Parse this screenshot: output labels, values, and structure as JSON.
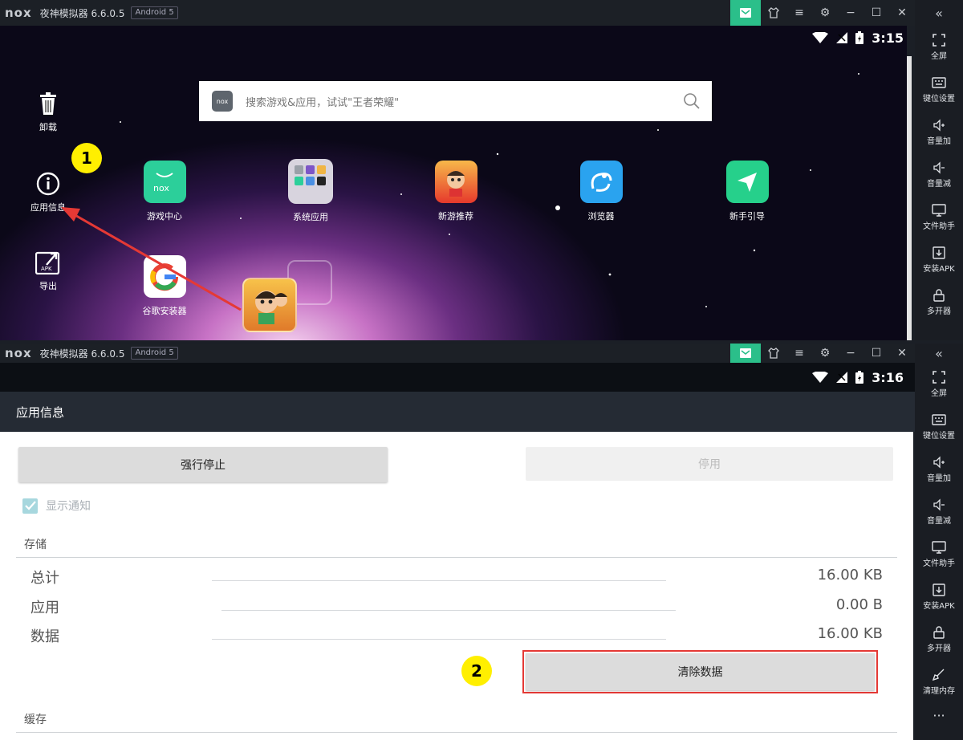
{
  "window1": {
    "logo": "nox",
    "title": "夜神模拟器 6.6.0.5",
    "os_badge": "Android 5",
    "status_time": "3:15",
    "search_placeholder": "搜索游戏&应用，试试\"王者荣耀\"",
    "drop_targets": [
      {
        "label": "卸载",
        "icon": "trash-icon"
      },
      {
        "label": "应用信息",
        "icon": "info-icon"
      },
      {
        "label": "导出",
        "icon": "export-apk-icon"
      }
    ],
    "apps": [
      {
        "label": "游戏中心",
        "icon": "nox-game-center-icon",
        "color": "#2ccf9a"
      },
      {
        "label": "系统应用",
        "icon": "folder-icon",
        "color": "#d8d4de"
      },
      {
        "label": "新游推荐",
        "icon": "new-games-icon",
        "color": "#e6392c"
      },
      {
        "label": "浏览器",
        "icon": "browser-icon",
        "color": "#2aa3ef"
      },
      {
        "label": "新手引导",
        "icon": "guide-icon",
        "color": "#26d08b"
      },
      {
        "label": "谷歌安装器",
        "icon": "google-icon",
        "color": "#ffffff"
      }
    ],
    "badge": "1"
  },
  "window2": {
    "logo": "nox",
    "title": "夜神模拟器 6.6.0.5",
    "os_badge": "Android 5",
    "status_time": "3:16",
    "page_title": "应用信息",
    "force_stop": "强行停止",
    "disable": "停用",
    "show_notifications": "显示通知",
    "storage_header": "存储",
    "storage_rows": [
      {
        "label": "总计",
        "value": "16.00 KB"
      },
      {
        "label": "应用",
        "value": "0.00 B"
      },
      {
        "label": "数据",
        "value": "16.00 KB"
      }
    ],
    "clear_data": "清除数据",
    "cache_header": "缓存",
    "badge": "2"
  },
  "sidebar": {
    "items": [
      {
        "label": "全屏",
        "icon": "fullscreen-icon"
      },
      {
        "label": "键位设置",
        "icon": "keyboard-icon"
      },
      {
        "label": "音量加",
        "icon": "volume-up-icon"
      },
      {
        "label": "音量减",
        "icon": "volume-down-icon"
      },
      {
        "label": "文件助手",
        "icon": "file-assistant-icon"
      },
      {
        "label": "安装APK",
        "icon": "install-apk-icon"
      },
      {
        "label": "多开器",
        "icon": "multi-instance-icon"
      },
      {
        "label": "清理内存",
        "icon": "clean-memory-icon"
      }
    ],
    "more": "···"
  },
  "colors": {
    "accent": "#2bbf8a",
    "highlight_red": "#e53935",
    "badge_yellow": "#ffef00"
  }
}
